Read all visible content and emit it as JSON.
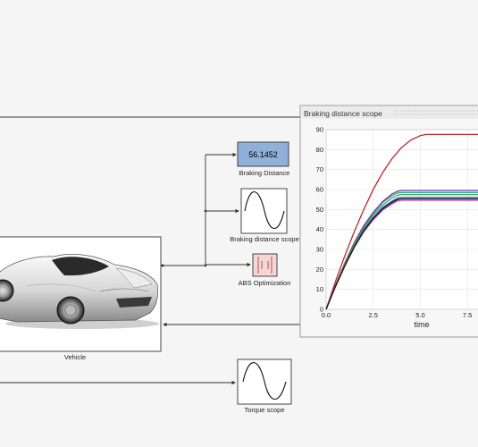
{
  "model": {
    "vehicle_label": "Vehicle",
    "braking_distance_label": "Braking Distance",
    "braking_distance_value": "56.1452",
    "scope_block_label": "Braking distance scope",
    "abs_label": "ABS Optimization",
    "torque_label": "Torque scope"
  },
  "colors": {
    "canvas_bg": "#f5f5f5",
    "display_fill": "#8fb0d8",
    "abs_fill": "#f4d6d6"
  },
  "scope_window": {
    "title": "Braking distance scope"
  },
  "chart_data": {
    "type": "line",
    "title": "Braking distance scope",
    "xlabel": "time",
    "ylabel": "",
    "xlim": [
      0,
      8.3
    ],
    "ylim": [
      0,
      90
    ],
    "x_ticks": [
      "0.0",
      "2.5",
      "5.0",
      "7.5"
    ],
    "y_ticks": [
      "0",
      "10",
      "20",
      "30",
      "40",
      "50",
      "60",
      "70",
      "80",
      "90"
    ],
    "grid": true,
    "series": [
      {
        "color": "#c0282d",
        "values": [
          [
            0,
            0
          ],
          [
            0.5,
            14
          ],
          [
            1.0,
            27
          ],
          [
            1.5,
            39
          ],
          [
            2.0,
            50
          ],
          [
            2.5,
            60
          ],
          [
            3.0,
            68.5
          ],
          [
            3.5,
            75.5
          ],
          [
            4.0,
            81
          ],
          [
            4.5,
            84.8
          ],
          [
            5.0,
            87
          ],
          [
            5.3,
            87.6
          ],
          [
            8.3,
            87.6
          ]
        ]
      },
      {
        "color": "#2ca9a0",
        "values": [
          [
            0,
            0
          ],
          [
            0.5,
            12
          ],
          [
            1.0,
            23
          ],
          [
            1.5,
            33
          ],
          [
            2.0,
            41.5
          ],
          [
            2.5,
            48
          ],
          [
            3.0,
            53.5
          ],
          [
            3.5,
            57
          ],
          [
            3.8,
            58.3
          ],
          [
            4.0,
            58.5
          ],
          [
            8.3,
            58.5
          ]
        ]
      },
      {
        "color": "#7a3fa0",
        "values": [
          [
            0,
            0
          ],
          [
            0.5,
            12.2
          ],
          [
            1.0,
            23.4
          ],
          [
            1.5,
            33.5
          ],
          [
            2.0,
            42
          ],
          [
            2.5,
            48.6
          ],
          [
            3.0,
            54
          ],
          [
            3.5,
            57.8
          ],
          [
            3.8,
            59.2
          ],
          [
            4.0,
            59.5
          ],
          [
            8.3,
            59.5
          ]
        ]
      },
      {
        "color": "#2b4fb8",
        "values": [
          [
            0,
            0
          ],
          [
            0.5,
            11.6
          ],
          [
            1.0,
            22.3
          ],
          [
            1.5,
            31.8
          ],
          [
            2.0,
            39.8
          ],
          [
            2.5,
            46
          ],
          [
            3.0,
            51
          ],
          [
            3.5,
            54.2
          ],
          [
            3.8,
            55.7
          ],
          [
            4.0,
            56
          ],
          [
            8.3,
            56
          ]
        ]
      },
      {
        "color": "#3aa84a",
        "values": [
          [
            0,
            0
          ],
          [
            0.5,
            11.9
          ],
          [
            1.0,
            22.8
          ],
          [
            1.5,
            32.5
          ],
          [
            2.0,
            40.8
          ],
          [
            2.5,
            47.2
          ],
          [
            3.0,
            52.2
          ],
          [
            3.5,
            55.8
          ],
          [
            3.8,
            57.2
          ],
          [
            4.0,
            57.5
          ],
          [
            8.3,
            57.5
          ]
        ]
      },
      {
        "color": "#d94cb8",
        "values": [
          [
            0,
            0
          ],
          [
            0.5,
            11.3
          ],
          [
            1.0,
            21.7
          ],
          [
            1.5,
            31
          ],
          [
            2.0,
            38.8
          ],
          [
            2.5,
            44.8
          ],
          [
            3.0,
            49.7
          ],
          [
            3.5,
            52.8
          ],
          [
            3.8,
            54.3
          ],
          [
            4.0,
            54.6
          ],
          [
            8.3,
            54.6
          ]
        ]
      },
      {
        "color": "#1a1a1a",
        "values": [
          [
            0,
            0
          ],
          [
            0.5,
            11.5
          ],
          [
            1.0,
            22
          ],
          [
            1.5,
            31.4
          ],
          [
            2.0,
            39.3
          ],
          [
            2.5,
            45.4
          ],
          [
            3.0,
            50.3
          ],
          [
            3.5,
            53.5
          ],
          [
            3.8,
            55
          ],
          [
            4.0,
            55.3
          ],
          [
            8.3,
            55.3
          ]
        ]
      }
    ]
  }
}
